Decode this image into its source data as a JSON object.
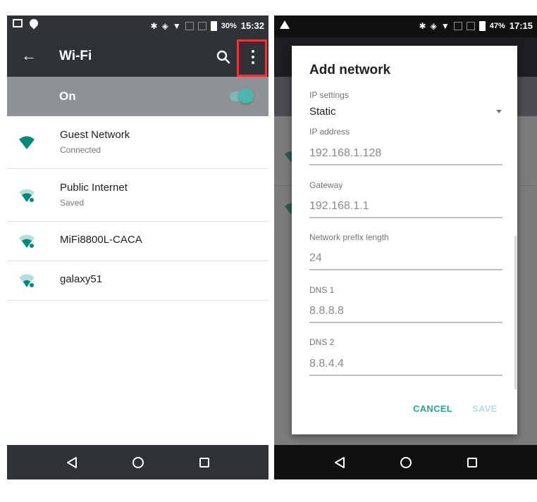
{
  "left_screen": {
    "status_bar": {
      "battery": "30%",
      "time": "15:32"
    },
    "app_bar": {
      "title": "Wi-Fi"
    },
    "wifi_toggle": {
      "label": "On",
      "state": "on"
    },
    "networks": [
      {
        "name": "Guest Network",
        "status": "Connected"
      },
      {
        "name": "Public Internet",
        "status": "Saved"
      },
      {
        "name": "MiFi8800L-CACA",
        "status": ""
      },
      {
        "name": "galaxy51",
        "status": ""
      }
    ]
  },
  "right_screen": {
    "status_bar": {
      "battery": "47%",
      "time": "17:15"
    },
    "dialog": {
      "title": "Add network",
      "ip_settings": {
        "label": "IP settings",
        "value": "Static"
      },
      "ip_address": {
        "label": "IP address",
        "value": "192.168.1.128"
      },
      "gateway": {
        "label": "Gateway",
        "value": "192.168.1.1"
      },
      "prefix_length": {
        "label": "Network prefix length",
        "value": "24"
      },
      "dns1": {
        "label": "DNS 1",
        "value": "8.8.8.8"
      },
      "dns2": {
        "label": "DNS 2",
        "value": "8.8.4.4"
      },
      "cancel_label": "CANCEL",
      "save_label": "SAVE"
    }
  },
  "colors": {
    "accent": "#26a69a",
    "appbar": "#2f3338",
    "highlight_box": "#e53935"
  },
  "icons": [
    "back-arrow-icon",
    "search-icon",
    "more-vert-icon",
    "wifi-icon",
    "nav-back-icon",
    "nav-home-icon",
    "nav-recents-icon"
  ]
}
